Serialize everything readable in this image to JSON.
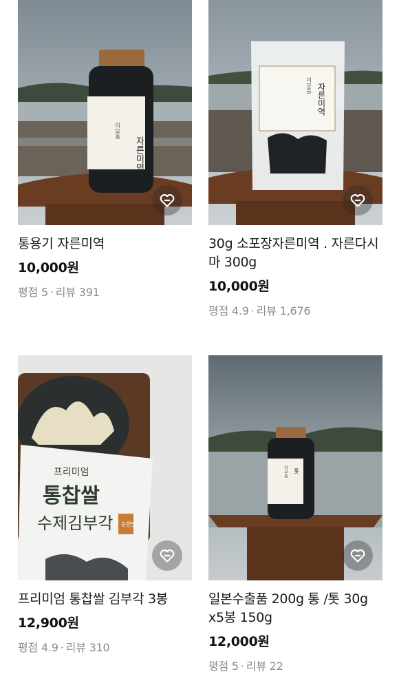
{
  "products": [
    {
      "name": "통용기 자른미역",
      "price": "10,000원",
      "rating_label": "평점 5",
      "review_label": "리뷰 391",
      "image_label": "자른미역",
      "image_brand": "이모품"
    },
    {
      "name": "30g 소포장자른미역 . 자른다시마 300g",
      "price": "10,000원",
      "rating_label": "평점 4.9",
      "review_label": "리뷰 1,676",
      "image_label": "자른미역",
      "image_brand": "이모품"
    },
    {
      "name": "프리미엄 통찹쌀 김부각 3봉",
      "price": "12,900원",
      "rating_label": "평점 4.9",
      "review_label": "리뷰 310",
      "image_label_top": "프리미엄",
      "image_label_main": "통찹쌀",
      "image_label_sub": "수제김부각",
      "image_badge": "순한맛"
    },
    {
      "name": "일본수출품 200g 통 /톳 30g x5봉 150g",
      "price": "12,000원",
      "rating_label": "평점 5",
      "review_label": "리뷰 22",
      "image_label": "톳",
      "image_brand": "이모품"
    }
  ],
  "separator": "·",
  "colors": {
    "text": "#1a1a1a",
    "meta": "#8a8a8a",
    "wish_bg": "rgba(40,40,40,0.35)"
  },
  "icons": {
    "wishlist": "heart-tag-icon"
  }
}
